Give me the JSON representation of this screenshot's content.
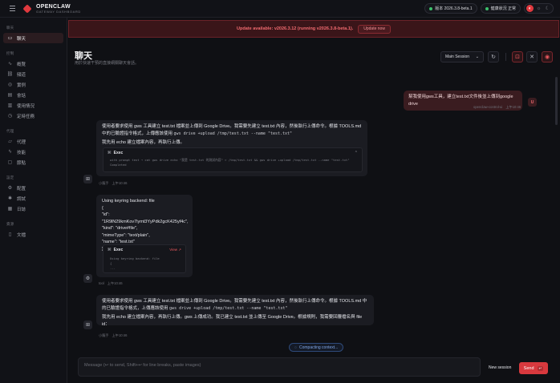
{
  "app": {
    "name": "OPENCLAW",
    "subtitle": "GATEWAY DASHBOARD"
  },
  "topbar": {
    "version_label": "版本 2026.3.8-beta.1",
    "health_label": "健康狀況 正常",
    "theme_icons": [
      "monitor-icon",
      "sun-icon",
      "moon-icon"
    ]
  },
  "sidebar": {
    "groups": [
      {
        "label": "聊天",
        "items": [
          {
            "label": "聊天",
            "icon": "chat-icon",
            "active": true
          }
        ]
      },
      {
        "label": "控制",
        "items": [
          {
            "label": "概覽",
            "icon": "chart-icon"
          },
          {
            "label": "頻道",
            "icon": "link-icon"
          },
          {
            "label": "實例",
            "icon": "radio-icon"
          },
          {
            "label": "會話",
            "icon": "document-icon"
          },
          {
            "label": "使用情況",
            "icon": "bar-chart-icon"
          },
          {
            "label": "定時任務",
            "icon": "clock-icon"
          }
        ]
      },
      {
        "label": "代理",
        "items": [
          {
            "label": "代理",
            "icon": "folder-icon"
          },
          {
            "label": "技能",
            "icon": "zap-icon"
          },
          {
            "label": "節點",
            "icon": "monitor-icon"
          }
        ]
      },
      {
        "label": "設定",
        "items": [
          {
            "label": "配置",
            "icon": "settings-icon"
          },
          {
            "label": "調試",
            "icon": "bug-icon"
          },
          {
            "label": "日誌",
            "icon": "file-text-icon"
          }
        ]
      },
      {
        "label": "資源",
        "items": [
          {
            "label": "文檔",
            "icon": "book-icon"
          }
        ]
      }
    ]
  },
  "banner": {
    "text": "Update available: v2026.3.12 (running v2026.3.8-beta.1).",
    "button": "Update now"
  },
  "header": {
    "title": "聊天",
    "subtitle": "用於快速干預的直接網關聊天會話。",
    "session": "Main Session"
  },
  "messages": {
    "user": {
      "text": "幫我使用gws工具，建立test.txt文件後並上傳到google drive",
      "sender": "openclaw-control-ui",
      "time": "上午10:46",
      "avatar": "U"
    },
    "a1": {
      "line1": "使用者要求使用 gws 工具建立 test.txt 檔案並上傳到 Google Drive。我需要先建立 test.txt 內容，然後執行上傳命令。根據 TOOLS.md 中的已驗證指令格式，上傳應該使用",
      "line1_code": "gws drive +upload /tmp/test.txt --name \"test.txt\"",
      "line2": "我先用 echo 建立檔案內容，再執行上傳。",
      "tool_name": "Exec",
      "tool_cmd": "with prompt text → cat gws drive  echo \"我是 test.txt 的測試內容\" > /tmp/test.txt && gws drive +upload /tmp/test.txt --name \"test.txt\"",
      "tool_status": "Completed",
      "sender": "小龍手",
      "time": "上午10:46"
    },
    "a2": {
      "lines": [
        "Using keyring backend: file",
        "{",
        "\"id\": \"1R9lN29kmKov7lymt3YyPdk2gcK425yf4c\",",
        "\"kind\": \"drive#file\",",
        "\"mimeType\": \"text/plain\",",
        "\"name\": \"test.txt\"",
        "}"
      ],
      "tool_name": "Exec",
      "tool_view": "View ↗",
      "tool_output": [
        "Using keyring backend: file",
        "{",
        "  ..."
      ],
      "sender": "tool",
      "time": "上午10:46"
    },
    "a3": {
      "line1": "使用者要求使用 gws 工具建立 test.txt 檔案並上傳到 Google Drive。我需要先建立 test.txt 內容，然後執行上傳命令。根據 TOOLS.md 中的已驗證指令格式，上傳應該使用",
      "line1_code": "gws drive +upload /tmp/test.txt --name \"test.txt\"",
      "line2": "我先用 echo 建立檔案內容，再執行上傳。gws 上傳成功。我已建立 test.txt 並上傳至 Google Drive。根據規則，我需要回覆檔名與 file id：",
      "sender": "小龍手",
      "time": "上午10:46"
    }
  },
  "compacting": "Compacting context...",
  "composer": {
    "placeholder": "Message (↩ to send, Shift+↩ for line breaks, paste images)",
    "new_session": "New session",
    "send": "Send",
    "send_kbd": "↵"
  }
}
